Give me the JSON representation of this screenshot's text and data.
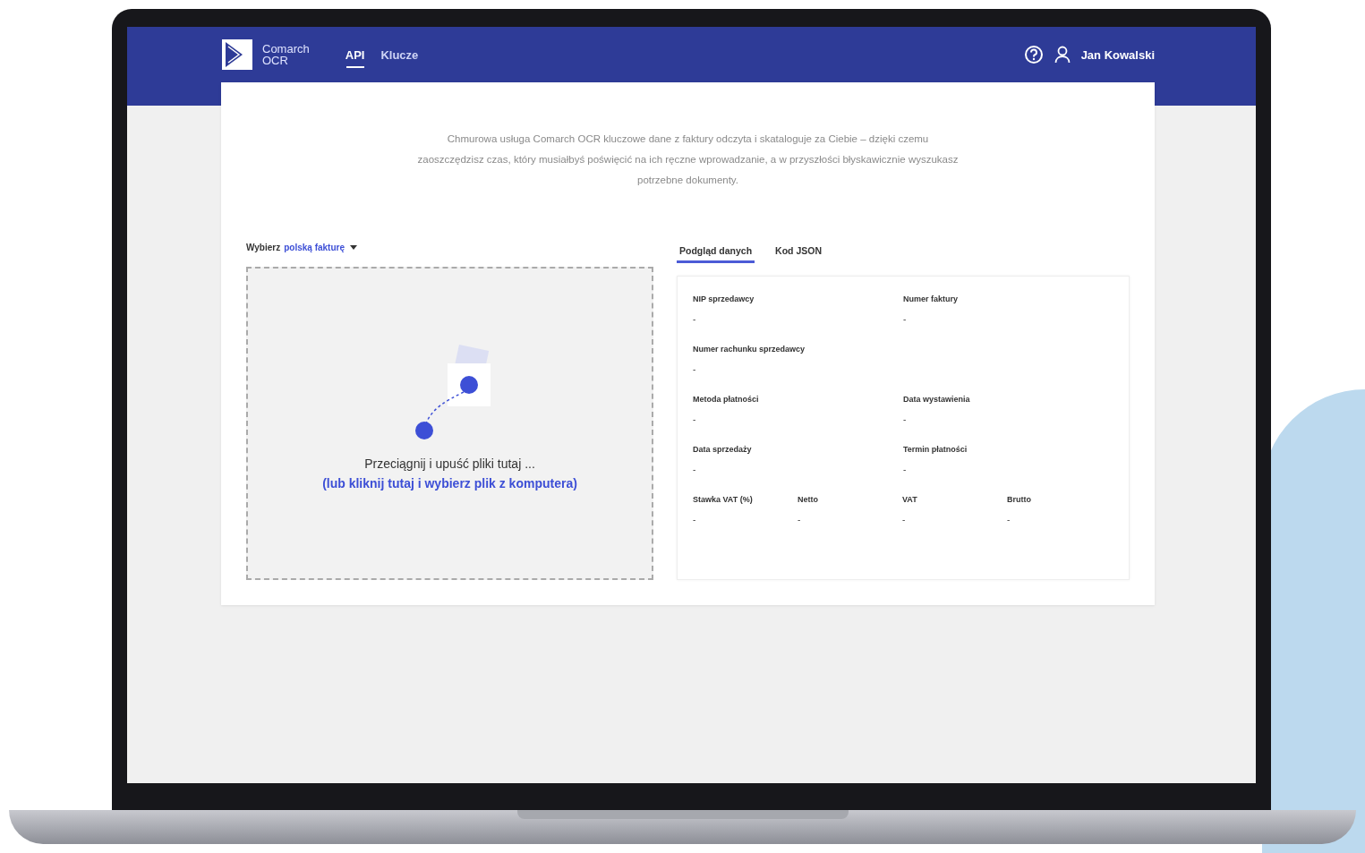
{
  "header": {
    "logo_line1": "Comarch",
    "logo_line2": "OCR",
    "nav": [
      {
        "label": "API",
        "selected": true
      },
      {
        "label": "Klucze",
        "selected": false
      }
    ],
    "user": "Jan Kowalski"
  },
  "intro": "Chmurowa usługa Comarch OCR kluczowe dane z faktury odczyta i skataloguje za Ciebie – dzięki czemu zaoszczędzisz czas, który musiałbyś poświęcić na ich ręczne wprowadzanie, a w przyszłości błyskawicznie wyszukasz potrzebne dokumenty.",
  "invoice_select": {
    "label": "Wybierz",
    "value": "polską fakturę"
  },
  "upload": {
    "text": "Przeciągnij i upuść pliki tutaj ...",
    "link": "(lub kliknij tutaj i wybierz plik z komputera)"
  },
  "tabs": [
    {
      "label": "Podgląd danych",
      "selected": true
    },
    {
      "label": "Kod JSON",
      "selected": false
    }
  ],
  "field_rows": [
    [
      {
        "label": "NIP sprzedawcy",
        "value": "-"
      },
      {
        "label": "Numer faktury",
        "value": "-"
      }
    ],
    [
      {
        "label": "Numer rachunku sprzedawcy",
        "value": "-"
      }
    ],
    [
      {
        "label": "Metoda płatności",
        "value": "-"
      },
      {
        "label": "Data wystawienia",
        "value": "-"
      }
    ],
    [
      {
        "label": "Data sprzedaży",
        "value": "-"
      },
      {
        "label": "Termin płatności",
        "value": "-"
      }
    ],
    [
      {
        "label": "Stawka VAT (%)",
        "value": "-"
      },
      {
        "label": "Netto",
        "value": "-"
      },
      {
        "label": "VAT",
        "value": "-"
      },
      {
        "label": "Brutto",
        "value": "-"
      }
    ]
  ]
}
